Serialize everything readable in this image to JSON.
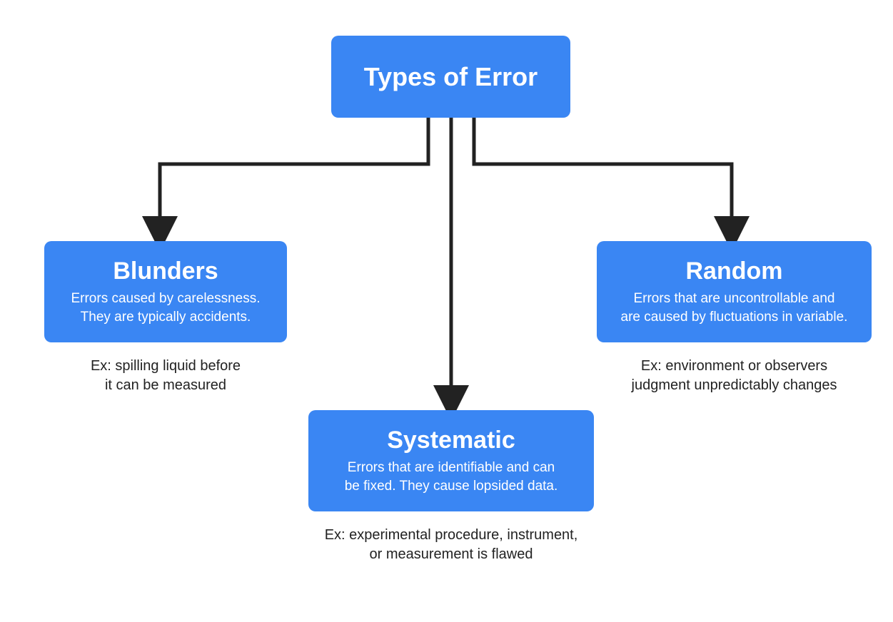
{
  "colors": {
    "node_bg": "#3a86f3",
    "arrow": "#222222"
  },
  "root": {
    "title": "Types of Error"
  },
  "children": {
    "blunders": {
      "title": "Blunders",
      "desc": "Errors caused by carelessness.\nThey are typically accidents.",
      "example": "Ex: spilling liquid before\nit can be measured"
    },
    "systematic": {
      "title": "Systematic",
      "desc": "Errors that are identifiable and can\nbe fixed. They cause lopsided data.",
      "example": "Ex: experimental procedure, instrument,\nor measurement is flawed"
    },
    "random": {
      "title": "Random",
      "desc": "Errors that are uncontrollable and\nare caused by fluctuations in variable.",
      "example": "Ex: environment or observers\njudgment unpredictably changes"
    }
  }
}
